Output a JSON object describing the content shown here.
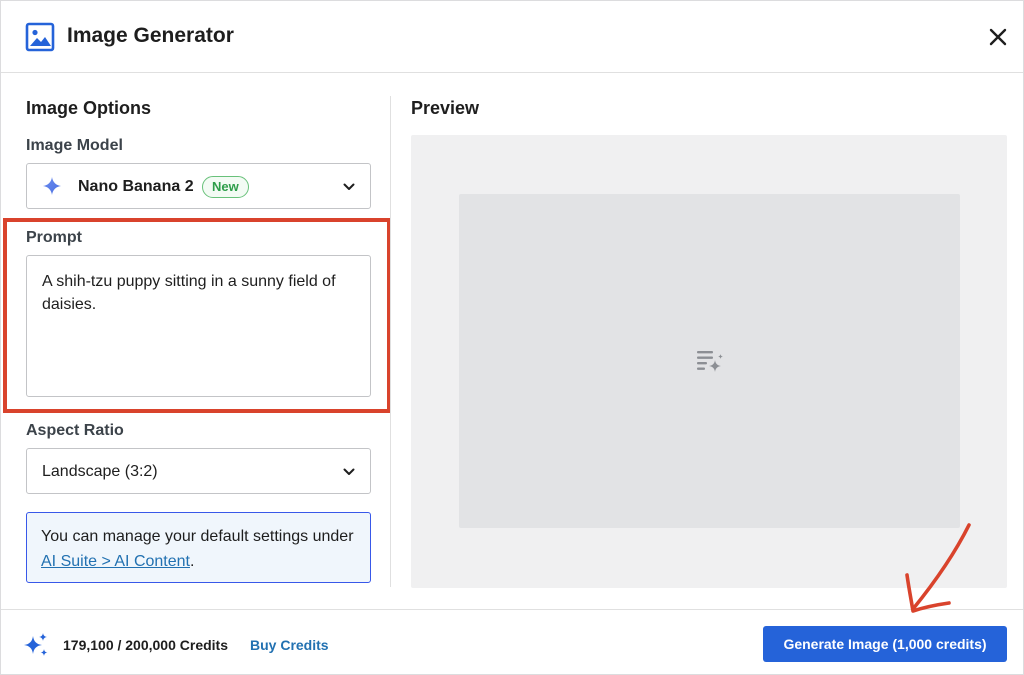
{
  "header": {
    "title": "Image Generator",
    "icon": "image-icon",
    "close_icon": "close-icon"
  },
  "options": {
    "title": "Image Options",
    "model": {
      "label": "Image Model",
      "value": "Nano Banana 2",
      "badge": "New",
      "icon": "sparkle-icon"
    },
    "prompt": {
      "label": "Prompt",
      "value": "A shih-tzu puppy sitting in a sunny field of daisies."
    },
    "aspect_ratio": {
      "label": "Aspect Ratio",
      "value": "Landscape (3:2)"
    },
    "info": {
      "text_before": "You can manage your default settings under ",
      "link": "AI Suite > AI Content",
      "text_after": "."
    }
  },
  "preview": {
    "title": "Preview",
    "placeholder_icon": "text-sparkle-icon"
  },
  "footer": {
    "credits": "179,100 / 200,000 Credits",
    "buy_label": "Buy Credits",
    "generate_label": "Generate Image (1,000 credits)"
  },
  "colors": {
    "accent": "#2563d9",
    "link": "#2271b1",
    "highlight": "#d9432c",
    "badge_green": "#2e9e4a"
  }
}
